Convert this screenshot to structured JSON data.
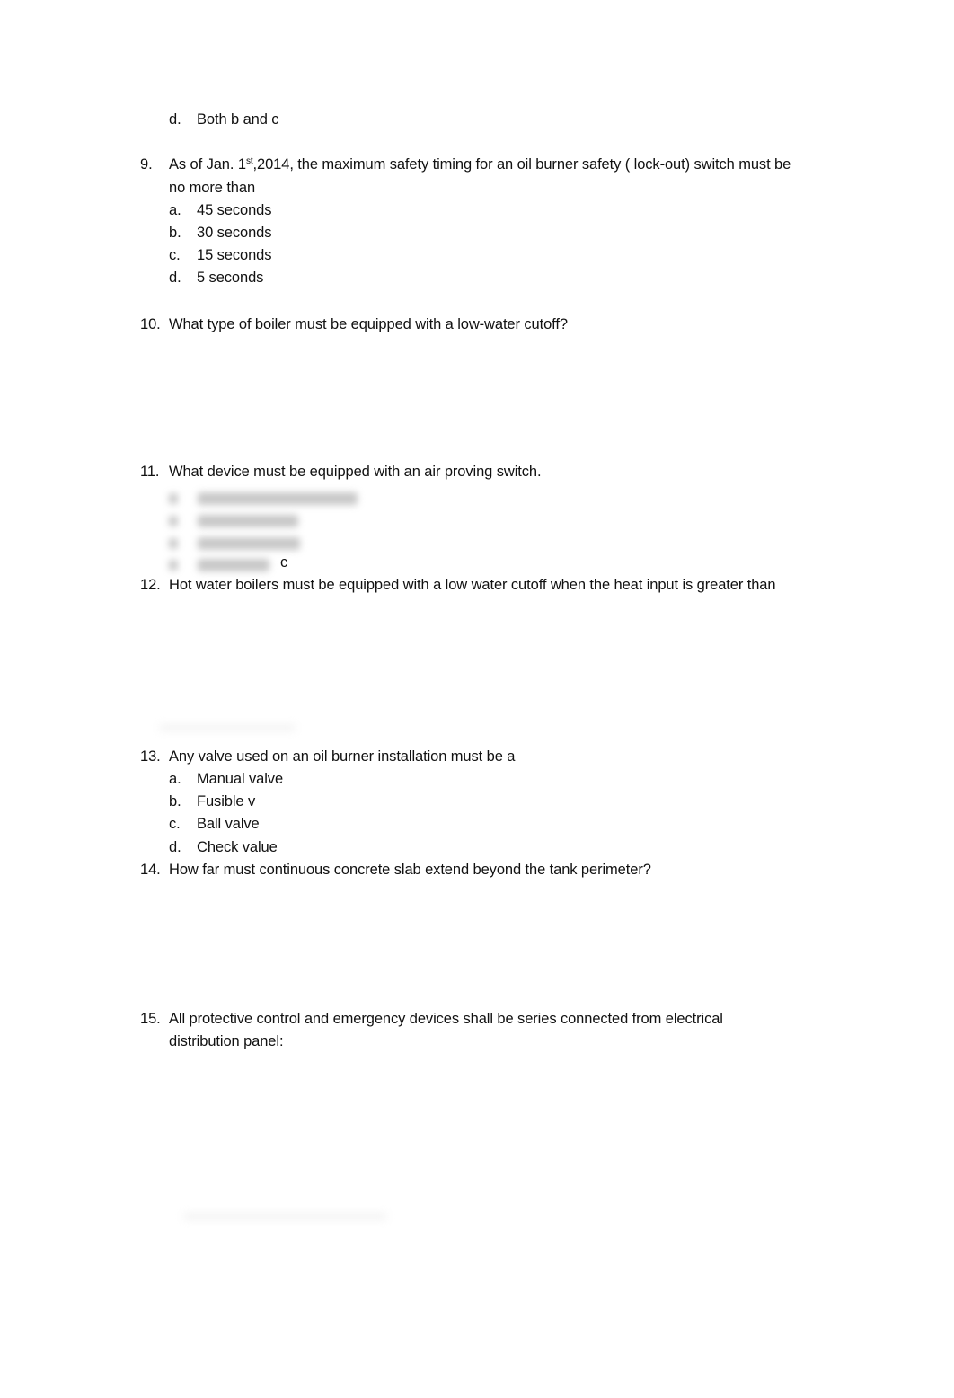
{
  "document": {
    "top_option": {
      "label": "d.",
      "text": "Both b and c"
    },
    "questions": [
      {
        "number": "9.",
        "text_parts": [
          "As of Jan. 1",
          "st",
          ",2014, the maximum safety timing for an oil burner safety ( lock-out) switch must be"
        ],
        "text_line2": "no more than",
        "options": [
          {
            "label": "a.",
            "text": "45 seconds"
          },
          {
            "label": "b.",
            "text": "30 seconds"
          },
          {
            "label": "c.",
            "text": "15 seconds"
          },
          {
            "label": "d.",
            "text": "5 seconds"
          }
        ]
      },
      {
        "number": "10.",
        "text": "What type of boiler must be equipped with a low-water cutoff?"
      },
      {
        "number": "11.",
        "text": "What device must be equipped with an air proving switch.",
        "trailing_mark": "c"
      },
      {
        "number": "12.",
        "text": "Hot water boilers must be equipped with a low water cutoff when the heat input is greater than"
      },
      {
        "number": "13.",
        "text": "Any valve used on an oil burner installation must be a",
        "options": [
          {
            "label": "a.",
            "text": "Manual valve"
          },
          {
            "label": "b.",
            "text": "Fusible v"
          },
          {
            "label": "c.",
            "text": "Ball valve"
          },
          {
            "label": "d.",
            "text": "Check value"
          }
        ]
      },
      {
        "number": "14.",
        "text": "How far must continuous concrete slab extend beyond the tank perimeter?"
      },
      {
        "number": "15.",
        "text": "All protective control and emergency devices shall be series connected from electrical",
        "text_line2": "distribution panel:"
      }
    ]
  }
}
